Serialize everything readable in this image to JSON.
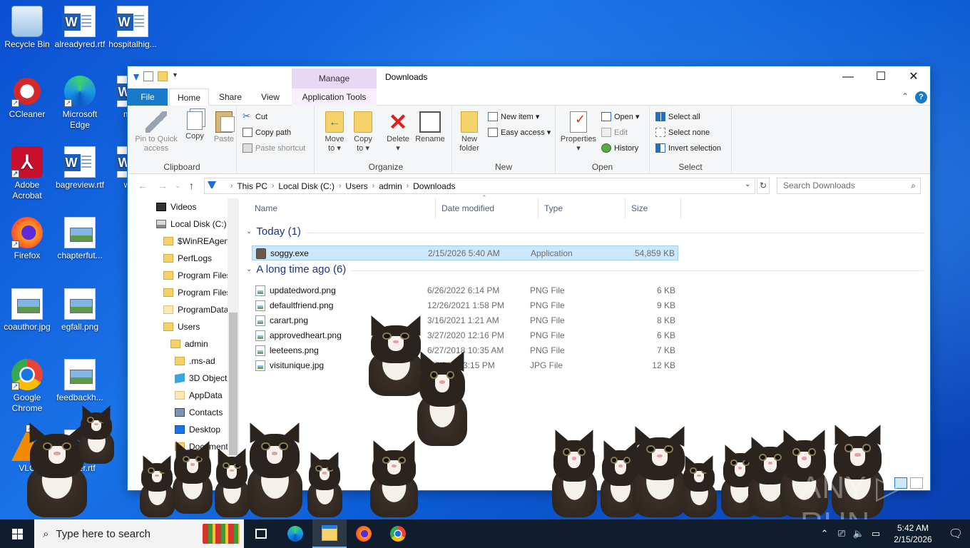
{
  "desktop": {
    "icons": [
      {
        "label": "Recycle Bin",
        "icon": "recycle-bin-icon"
      },
      {
        "label": "alreadyred.rtf",
        "icon": "word-document-icon"
      },
      {
        "label": "hospitalhig...",
        "icon": "word-document-icon"
      },
      {
        "label": "CCleaner",
        "icon": "ccleaner-icon"
      },
      {
        "label": "Microsoft Edge",
        "icon": "edge-icon"
      },
      {
        "label": "male",
        "icon": "word-document-icon"
      },
      {
        "label": "Adobe Acrobat",
        "icon": "acrobat-icon"
      },
      {
        "label": "bagreview.rtf",
        "icon": "word-document-icon"
      },
      {
        "label": "wine",
        "icon": "word-document-icon"
      },
      {
        "label": "Firefox",
        "icon": "firefox-icon"
      },
      {
        "label": "chapterfut...",
        "icon": "image-file-icon"
      },
      {
        "label": "coauthor.jpg",
        "icon": "image-file-icon"
      },
      {
        "label": "egfall.png",
        "icon": "image-file-icon"
      },
      {
        "label": "Google Chrome",
        "icon": "chrome-icon"
      },
      {
        "label": "feedbackh...",
        "icon": "image-file-icon"
      },
      {
        "label": "VLC",
        "icon": "vlc-icon"
      },
      {
        "label": "duser.rtf",
        "icon": "word-document-icon"
      }
    ]
  },
  "window": {
    "title": "Downloads",
    "manage_label": "Manage",
    "controls": {
      "minimize": "—",
      "maximize": "☐",
      "close": "✕"
    },
    "tabs": {
      "file": "File",
      "home": "Home",
      "share": "Share",
      "view": "View",
      "app_tools": "Application Tools"
    },
    "help": "?",
    "ribbon": {
      "clipboard": {
        "label": "Clipboard",
        "pin": "Pin to Quick access",
        "copy": "Copy",
        "paste": "Paste",
        "cut": "Cut",
        "copy_path": "Copy path",
        "paste_shortcut": "Paste shortcut"
      },
      "organize": {
        "label": "Organize",
        "move_to": "Move to ▾",
        "copy_to": "Copy to ▾",
        "delete": "Delete ▾",
        "rename": "Rename"
      },
      "new": {
        "label": "New",
        "new_folder": "New folder",
        "new_item": "New item ▾",
        "easy_access": "Easy access ▾"
      },
      "open": {
        "label": "Open",
        "properties": "Properties ▾",
        "open": "Open ▾",
        "edit": "Edit",
        "history": "History"
      },
      "select": {
        "label": "Select",
        "select_all": "Select all",
        "select_none": "Select none",
        "invert": "Invert selection"
      }
    },
    "address": {
      "crumbs": [
        "This PC",
        "Local Disk (C:)",
        "Users",
        "admin",
        "Downloads"
      ],
      "search_placeholder": "Search Downloads"
    },
    "nav": [
      {
        "label": "Videos",
        "icon": "videos-icon",
        "indent": 1
      },
      {
        "label": "Local Disk (C:)",
        "icon": "disk-icon",
        "indent": 1
      },
      {
        "label": "$WinREAgent",
        "icon": "folder-icon",
        "indent": 2
      },
      {
        "label": "PerfLogs",
        "icon": "folder-icon",
        "indent": 2
      },
      {
        "label": "Program Files",
        "icon": "folder-icon",
        "indent": 2
      },
      {
        "label": "Program Files",
        "icon": "folder-icon",
        "indent": 2
      },
      {
        "label": "ProgramData",
        "icon": "folder-icon",
        "indent": 2
      },
      {
        "label": "Users",
        "icon": "folder-icon",
        "indent": 2
      },
      {
        "label": "admin",
        "icon": "folder-icon",
        "indent": 3
      },
      {
        "label": ".ms-ad",
        "icon": "folder-icon",
        "indent": 4
      },
      {
        "label": "3D Objects",
        "icon": "3d-objects-icon",
        "indent": 4
      },
      {
        "label": "AppData",
        "icon": "folder-icon",
        "indent": 4
      },
      {
        "label": "Contacts",
        "icon": "contacts-icon",
        "indent": 4
      },
      {
        "label": "Desktop",
        "icon": "desktop-icon",
        "indent": 4
      },
      {
        "label": "Documents",
        "icon": "folder-icon",
        "indent": 4
      }
    ],
    "columns": {
      "name": "Name",
      "date": "Date modified",
      "type": "Type",
      "size": "Size"
    },
    "groups": [
      {
        "title": "Today (1)",
        "files": [
          {
            "name": "soggy.exe",
            "date": "2/15/2026 5:40 AM",
            "type": "Application",
            "size": "54,859 KB",
            "selected": true,
            "kind": "app"
          }
        ]
      },
      {
        "title": "A long time ago (6)",
        "files": [
          {
            "name": "updatedword.png",
            "date": "6/26/2022 6:14 PM",
            "type": "PNG File",
            "size": "6 KB",
            "kind": "img"
          },
          {
            "name": "defaultfriend.png",
            "date": "12/26/2021 1:58 PM",
            "type": "PNG File",
            "size": "9 KB",
            "kind": "img"
          },
          {
            "name": "carart.png",
            "date": "3/16/2021 1:21 AM",
            "type": "PNG File",
            "size": "8 KB",
            "kind": "img"
          },
          {
            "name": "approvedheart.png",
            "date": "3/27/2020 12:16 PM",
            "type": "PNG File",
            "size": "6 KB",
            "kind": "img"
          },
          {
            "name": "leeteens.png",
            "date": "6/27/2018 10:35 AM",
            "type": "PNG File",
            "size": "7 KB",
            "kind": "img"
          },
          {
            "name": "visitunique.jpg",
            "date": "1/7/2017 3:15 PM",
            "type": "JPG File",
            "size": "12 KB",
            "kind": "img"
          }
        ]
      }
    ]
  },
  "watermark": "ANY ▷ RUN",
  "taskbar": {
    "search_placeholder": "Type here to search",
    "time": "5:42 AM",
    "date": "2/15/2026"
  }
}
